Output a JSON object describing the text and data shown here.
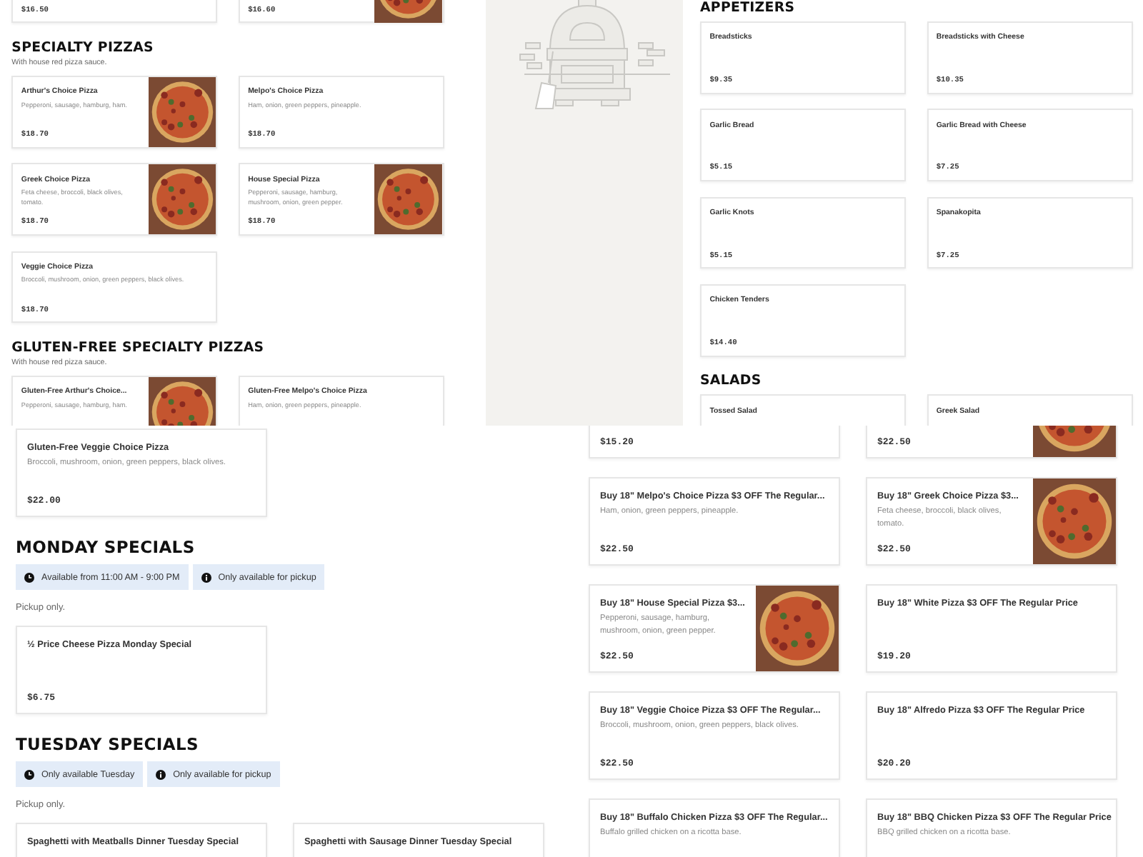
{
  "top_left": {
    "sections": [
      {
        "items": [
          {
            "price": "$16.50",
            "picture": false
          },
          {
            "price": "$16.60",
            "picture": true
          }
        ]
      },
      {
        "title": "SPECIALTY PIZZAS",
        "subtitle": "With house red pizza sauce.",
        "items": [
          {
            "name": "Arthur's Choice Pizza",
            "description": "Pepperoni, sausage, hamburg, ham.",
            "price": "$18.70",
            "picture": true
          },
          {
            "name": "Melpo's Choice Pizza",
            "description": "Ham, onion, green peppers, pineapple.",
            "price": "$18.70",
            "picture": false
          },
          {
            "name": "Greek Choice Pizza",
            "description": "Feta cheese, broccoli, black olives, tomato.",
            "price": "$18.70",
            "picture": true
          },
          {
            "name": "House Special Pizza",
            "description": "Pepperoni, sausage, hamburg, mushroom, onion, green pepper.",
            "price": "$18.70",
            "picture": true
          },
          {
            "name": "Veggie Choice Pizza",
            "description": "Broccoli, mushroom, onion, green peppers, black olives.",
            "price": "$18.70",
            "picture": false
          }
        ]
      },
      {
        "title": "GLUTEN-FREE SPECIALTY PIZZAS",
        "subtitle": "With house red pizza sauce.",
        "items": [
          {
            "name": "Gluten-Free Arthur's Choice...",
            "description": "Pepperoni, sausage, hamburg, ham.",
            "picture": true
          },
          {
            "name": "Gluten-Free Melpo's Choice Pizza",
            "description": "Ham, onion, green peppers, pineapple.",
            "picture": false
          }
        ]
      }
    ]
  },
  "top_right": {
    "sections": [
      {
        "title": "APPETIZERS",
        "items": [
          {
            "name": "Breadsticks",
            "price": "$9.35",
            "picture": false
          },
          {
            "name": "Breadsticks with Cheese",
            "price": "$10.35",
            "picture": false
          },
          {
            "name": "Garlic Bread",
            "price": "$5.15",
            "picture": false
          },
          {
            "name": "Garlic Bread with Cheese",
            "price": "$7.25",
            "picture": false
          },
          {
            "name": "Garlic Knots",
            "price": "$5.15",
            "picture": false
          },
          {
            "name": "Spanakopita",
            "price": "$7.25",
            "picture": false
          },
          {
            "name": "Chicken Tenders",
            "price": "$14.40",
            "picture": false
          }
        ]
      },
      {
        "title": "SALADS",
        "items": [
          {
            "name": "Tossed Salad",
            "picture": false
          },
          {
            "name": "Greek Salad",
            "picture": false
          }
        ]
      }
    ]
  },
  "bottom_left": {
    "sections": [
      {
        "items": [
          {
            "name": "Gluten-Free Veggie Choice Pizza",
            "description": "Broccoli, mushroom, onion, green peppers, black olives.",
            "price": "$22.00",
            "picture": false
          }
        ]
      },
      {
        "title": "MONDAY SPECIALS",
        "chips": [
          {
            "kind": "clock",
            "text": "Available from 11:00 AM - 9:00 PM"
          },
          {
            "kind": "info",
            "text": "Only available for pickup"
          }
        ],
        "note": "Pickup only.",
        "items": [
          {
            "name": "½ Price Cheese Pizza Monday Special",
            "price": "$6.75",
            "picture": false
          }
        ]
      },
      {
        "title": "TUESDAY SPECIALS",
        "chips": [
          {
            "kind": "clock",
            "text": "Only available Tuesday"
          },
          {
            "kind": "info",
            "text": "Only available for pickup"
          }
        ],
        "note": "Pickup only.",
        "items": [
          {
            "name": "Spaghetti with Meatballs Dinner Tuesday Special",
            "picture": false
          },
          {
            "name": "Spaghetti with Sausage Dinner Tuesday Special",
            "picture": false
          }
        ]
      }
    ]
  },
  "bottom_right": {
    "sections": [
      {
        "items": [
          {
            "price": "$15.20",
            "picture": false
          },
          {
            "price": "$22.50",
            "picture": true
          },
          {
            "name": "Buy 18\" Melpo's Choice Pizza $3 OFF The Regular...",
            "description": "Ham, onion, green peppers, pineapple.",
            "price": "$22.50",
            "picture": false
          },
          {
            "name": "Buy 18\" Greek Choice Pizza $3...",
            "description": "Feta cheese, broccoli, black olives, tomato.",
            "price": "$22.50",
            "picture": true
          },
          {
            "name": "Buy 18\" House Special Pizza $3...",
            "description": "Pepperoni, sausage, hamburg, mushroom, onion, green pepper.",
            "price": "$22.50",
            "picture": true
          },
          {
            "name": "Buy 18\" White Pizza $3 OFF The Regular Price",
            "price": "$19.20",
            "picture": false
          },
          {
            "name": "Buy 18\" Veggie Choice Pizza $3 OFF The Regular...",
            "description": "Broccoli, mushroom, onion, green peppers, black olives.",
            "price": "$22.50",
            "picture": false
          },
          {
            "name": "Buy 18\" Alfredo Pizza $3 OFF The Regular Price",
            "price": "$20.20",
            "picture": false
          },
          {
            "name": "Buy 18\" Buffalo Chicken Pizza $3 OFF The Regular...",
            "description": "Buffalo grilled chicken on a ricotta base.",
            "picture": false
          },
          {
            "name": "Buy 18\" BBQ Chicken Pizza $3 OFF The Regular Price",
            "description": "BBQ grilled chicken on a ricotta base.",
            "picture": false
          }
        ]
      }
    ]
  }
}
